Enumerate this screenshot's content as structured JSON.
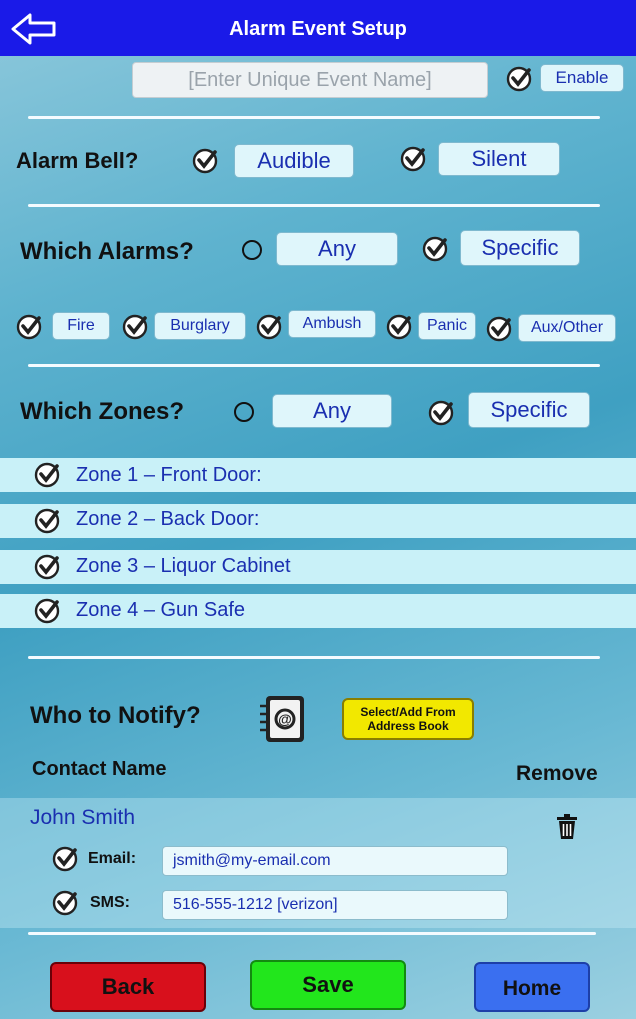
{
  "header": {
    "title": "Alarm Event Setup"
  },
  "event": {
    "name_placeholder": "[Enter Unique Event Name]",
    "enable_label": "Enable"
  },
  "alarm_bell": {
    "label": "Alarm Bell?",
    "audible": "Audible",
    "silent": "Silent"
  },
  "which_alarms": {
    "label": "Which Alarms?",
    "any": "Any",
    "specific": "Specific",
    "types": [
      "Fire",
      "Burglary",
      "Ambush",
      "Panic",
      "Aux/Other"
    ]
  },
  "which_zones": {
    "label": "Which Zones?",
    "any": "Any",
    "specific": "Specific",
    "zones": [
      "Zone 1 – Front Door:",
      "Zone 2 – Back Door:",
      "Zone 3 – Liquor Cabinet",
      "Zone 4 – Gun Safe"
    ]
  },
  "notify": {
    "label": "Who to Notify?",
    "address_book_btn": "Select/Add From Address Book",
    "contact_name_header": "Contact Name",
    "remove_header": "Remove",
    "contact": {
      "name": "John Smith",
      "email_label": "Email:",
      "email": "jsmith@my-email.com",
      "sms_label": "SMS:",
      "sms": "516-555-1212 [verizon]"
    }
  },
  "footer": {
    "back": "Back",
    "save": "Save",
    "home": "Home"
  },
  "colors": {
    "header": "#1a1ae8",
    "back": "#d8101c",
    "save": "#22e61c",
    "home": "#3a6ff0",
    "addr_btn": "#f2e800"
  }
}
